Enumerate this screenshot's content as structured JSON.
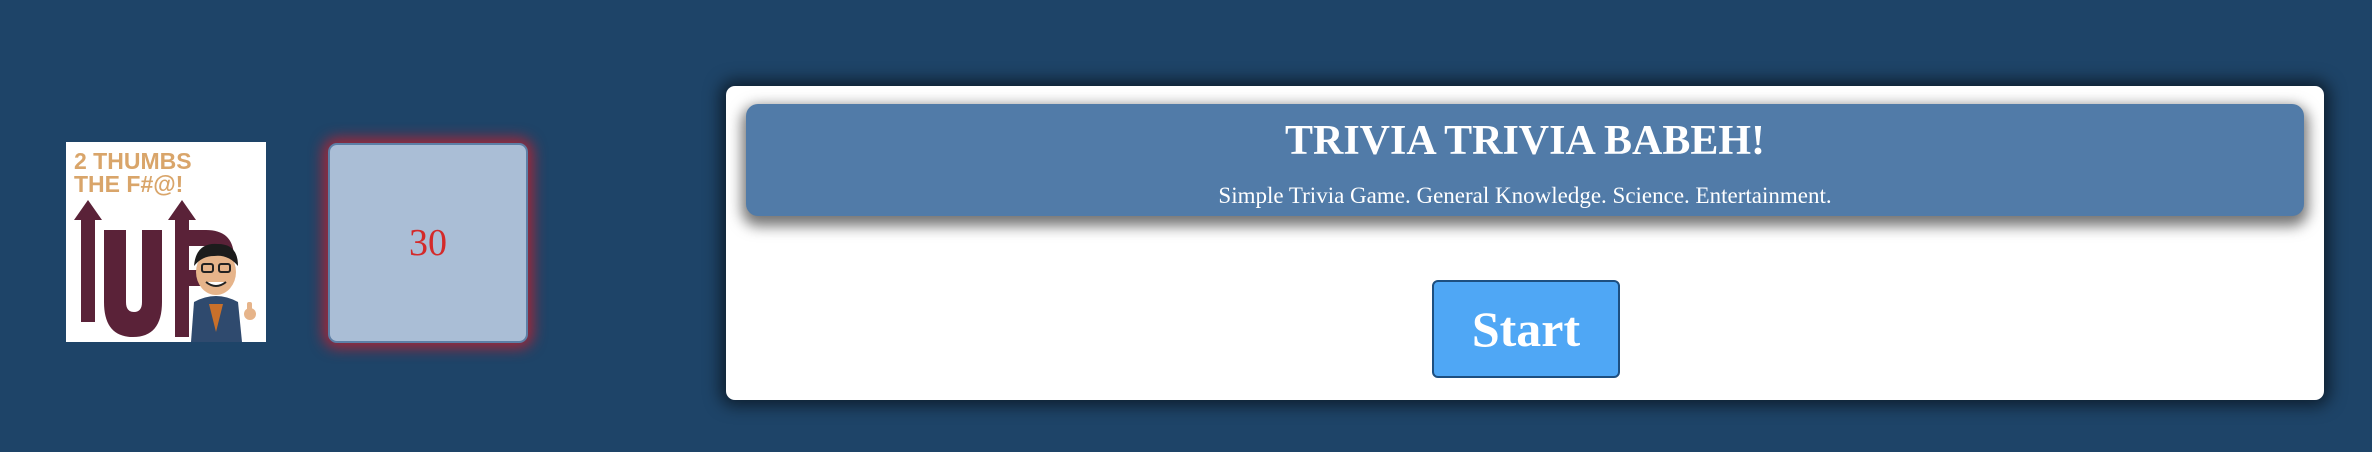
{
  "logo": {
    "line1": "2 THUMBS",
    "line2": "THE F#@!",
    "big_text": "UP",
    "accent_color": "#d9a56a",
    "up_color": "#5a2238"
  },
  "timer": {
    "value": "30",
    "text_color": "#d42a2a",
    "glow_color": "#d21e28"
  },
  "header": {
    "title": "TRIVIA TRIVIA BABEH!",
    "subtitle": "Simple Trivia Game. General Knowledge. Science. Entertainment."
  },
  "start_button": {
    "label": "Start",
    "color": "#4fa7f5"
  },
  "colors": {
    "background": "#1e4468",
    "header_bg": "#517ba8"
  }
}
